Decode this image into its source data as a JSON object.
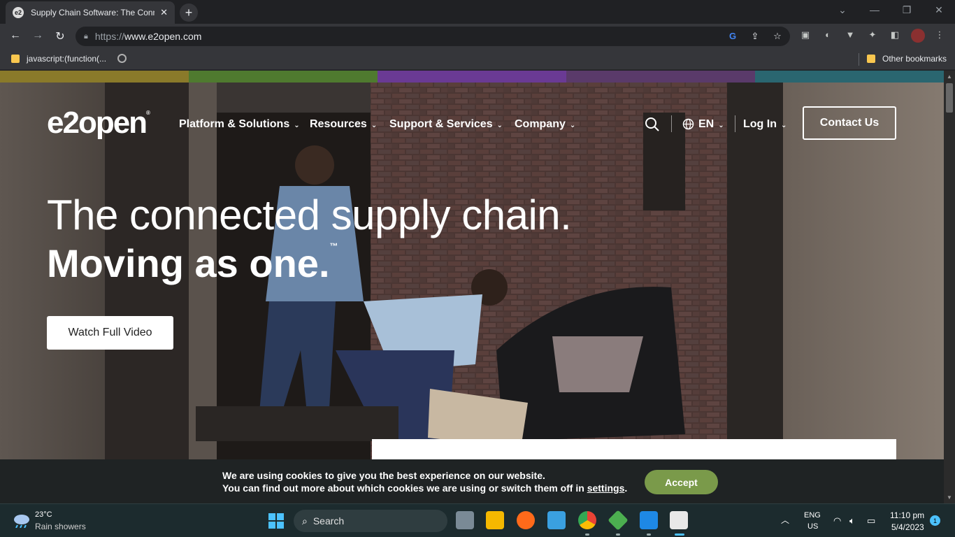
{
  "browser": {
    "tab_title": "Supply Chain Software: The Conn",
    "tab_close": "✕",
    "new_tab": "+",
    "url_scheme": "https://",
    "url_host": "www.e2open.com",
    "bookmark_1": "javascript:(function(...",
    "other_bookmarks": "Other bookmarks"
  },
  "site": {
    "logo": "e2open",
    "nav": [
      {
        "label": "Platform & Solutions"
      },
      {
        "label": "Resources"
      },
      {
        "label": "Support & Services"
      },
      {
        "label": "Company"
      }
    ],
    "language": "EN",
    "login": "Log In",
    "contact_button": "Contact Us",
    "hero_line1": "The connected supply chain.",
    "hero_line2": "Moving as one.",
    "hero_tm": "™",
    "watch_button": "Watch Full Video",
    "color_bar": [
      "#8a7a2a",
      "#4f7a2f",
      "#6a3a94",
      "#5a3a6a",
      "#2a6670"
    ]
  },
  "cookie": {
    "line1": "We are using cookies to give you the best experience on our website.",
    "line2_prefix": "You can find out more about which cookies we are using or switch them off in ",
    "line2_link": "settings",
    "line2_suffix": ".",
    "accept": "Accept"
  },
  "taskbar": {
    "weather_temp": "23°C",
    "weather_desc": "Rain showers",
    "search_label": "Search",
    "lang_line1": "ENG",
    "lang_line2": "US",
    "time": "11:10 pm",
    "date": "5/4/2023",
    "notification_count": "1",
    "apps": [
      "task-view",
      "file-explorer",
      "firefox",
      "notepad",
      "chrome",
      "git",
      "vscode",
      "snipping-tool"
    ]
  }
}
